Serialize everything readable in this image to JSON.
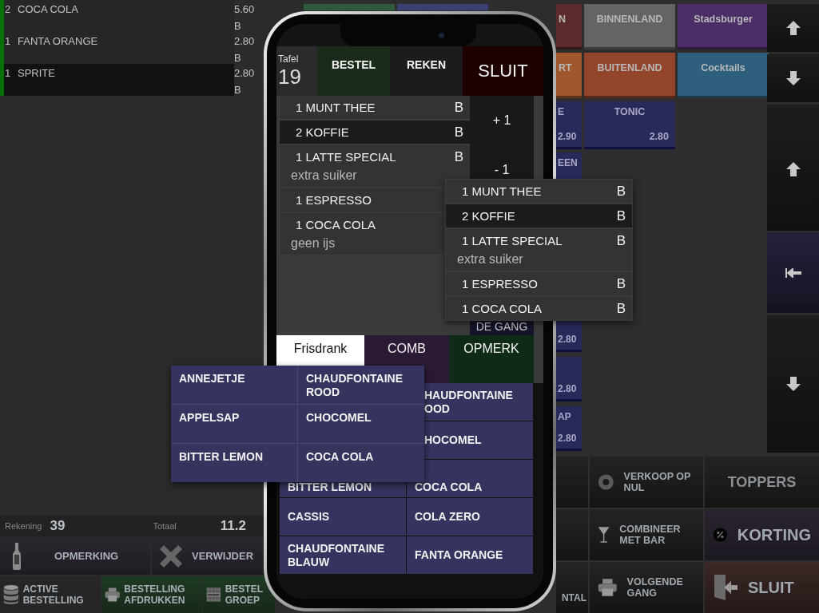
{
  "order_list": [
    {
      "qty": "2",
      "name": "COCA COLA",
      "price": "5.60",
      "badge": "B",
      "selected": false
    },
    {
      "qty": "1",
      "name": "FANTA ORANGE",
      "price": "2.80",
      "badge": "B",
      "selected": false
    },
    {
      "qty": "1",
      "name": "SPRITE",
      "price": "2.80",
      "badge": "B",
      "selected": true
    }
  ],
  "category_tiles": [
    {
      "kind": "blank",
      "color": "#2f5a3c"
    },
    {
      "kind": "blank",
      "color": "#3a3f74"
    },
    {
      "kind": "cut",
      "label": "N",
      "color": "#5c2b2b"
    },
    {
      "kind": "full",
      "label": "BINNENLAND",
      "color": "#646464"
    },
    {
      "kind": "full",
      "label": "Stadsburger",
      "color": "#4b2d67"
    },
    {
      "kind": "cut",
      "label": "RT",
      "color": "#a0572d"
    },
    {
      "kind": "full",
      "label": "BUITENLAND",
      "color": "#93452c"
    },
    {
      "kind": "full",
      "label": "Cocktails",
      "color": "#2e607d"
    }
  ],
  "products": [
    {
      "kind": "cut",
      "name": "E",
      "price": "2.90"
    },
    {
      "kind": "full",
      "name": "TONIC",
      "price": "2.80"
    }
  ],
  "product_column": [
    {
      "name": "EEN",
      "price": "2.80"
    },
    {
      "price": "2.80"
    },
    {
      "name": "AP",
      "price": "2.80"
    }
  ],
  "nav_buttons": [
    {
      "kind": "up"
    },
    {
      "kind": "down"
    },
    {
      "kind": "up"
    },
    {
      "kind": "first"
    },
    {
      "kind": "down"
    }
  ],
  "account": {
    "label": "Rekening",
    "number": "39",
    "total_label": "Totaal",
    "total": "11.2"
  },
  "actions": [
    {
      "kind": "note",
      "label": "OPMERKING"
    },
    {
      "kind": "delete",
      "label": "VERWIJDER"
    }
  ],
  "bottom_tabs": [
    {
      "kind": "database",
      "label": "ACTIVE BESTELLING",
      "selected": false
    },
    {
      "kind": "printer",
      "label": "BESTELLING AFDRUKKEN",
      "selected": true
    },
    {
      "kind": "grid",
      "label": "BESTEL GROEP",
      "selected": true
    }
  ],
  "function_buttons": [
    {
      "kind": "blank"
    },
    {
      "kind": "disc",
      "label": "VERKOOP OP NUL"
    },
    {
      "kind": "plain",
      "label": "TOPPERS"
    },
    {
      "kind": "blank"
    },
    {
      "kind": "glass",
      "label": "COMBINEER MET BAR"
    },
    {
      "kind": "discount",
      "label": "KORTING"
    },
    {
      "kind": "cut",
      "label": "NTAL"
    },
    {
      "kind": "printer",
      "label": "VOLGENDE GANG"
    },
    {
      "kind": "exit",
      "label": "SLUIT"
    }
  ],
  "phone": {
    "table_label": "Tafel",
    "table_number": "19",
    "header_buttons": [
      {
        "kind": "order",
        "label": "BESTEL"
      },
      {
        "kind": "bill",
        "label": "REKEN"
      },
      {
        "kind": "close",
        "label": "SLUIT"
      }
    ],
    "order_lines": [
      {
        "text": "1 MUNT THEE",
        "badge": "B",
        "selected": false
      },
      {
        "text": "2 KOFFIE",
        "badge": "B",
        "selected": true
      },
      {
        "text": "1 LATTE SPECIAL",
        "badge": "B",
        "note": "extra suiker",
        "selected": false
      },
      {
        "text": "1 ESPRESSO",
        "selected": false
      },
      {
        "text": "1 COCA COLA",
        "note": "geen ijs",
        "selected": false
      }
    ],
    "side_buttons": [
      {
        "label": "+ 1"
      },
      {
        "label": "- 1"
      },
      {
        "label": "DE GANG"
      }
    ],
    "tabs": [
      {
        "label": "Frisdrank",
        "selected": true
      },
      {
        "label": "COMB",
        "selected": false,
        "color": "#2a1a33"
      },
      {
        "label": "OPMERK",
        "selected": false,
        "color": "#0f2a16"
      }
    ],
    "products": [
      {
        "kind": "cut",
        "name": "HAUDFONTAINE OOD"
      },
      {
        "kind": "cut",
        "name": "HOCOMEL"
      },
      {
        "kind": "low",
        "name": "BITTER LEMON"
      },
      {
        "kind": "low",
        "name": "COCA COLA"
      },
      {
        "kind": "full",
        "name": "CASSIS"
      },
      {
        "kind": "full",
        "name": "COLA ZERO"
      },
      {
        "kind": "full",
        "name": "CHAUDFONTAINE BLAUW"
      },
      {
        "kind": "full",
        "name": "FANTA ORANGE"
      }
    ]
  },
  "popup_order": {
    "lines": [
      {
        "text": "1 MUNT THEE",
        "badge": "B",
        "selected": false
      },
      {
        "text": "2 KOFFIE",
        "badge": "B",
        "selected": true
      },
      {
        "text": "1 LATTE SPECIAL",
        "badge": "B",
        "note": "extra suiker",
        "selected": false
      },
      {
        "text": "1 ESPRESSO",
        "badge": "B",
        "selected": false
      },
      {
        "text": "1 COCA COLA",
        "badge": "B",
        "selected": false
      }
    ]
  },
  "popup_products": {
    "items": [
      {
        "name": "ANNEJETJE"
      },
      {
        "name": "CHAUDFONTAINE ROOD"
      },
      {
        "name": "APPELSAP"
      },
      {
        "name": "CHOCOMEL"
      },
      {
        "name": "BITTER LEMON"
      },
      {
        "name": "COCA COLA"
      }
    ]
  }
}
